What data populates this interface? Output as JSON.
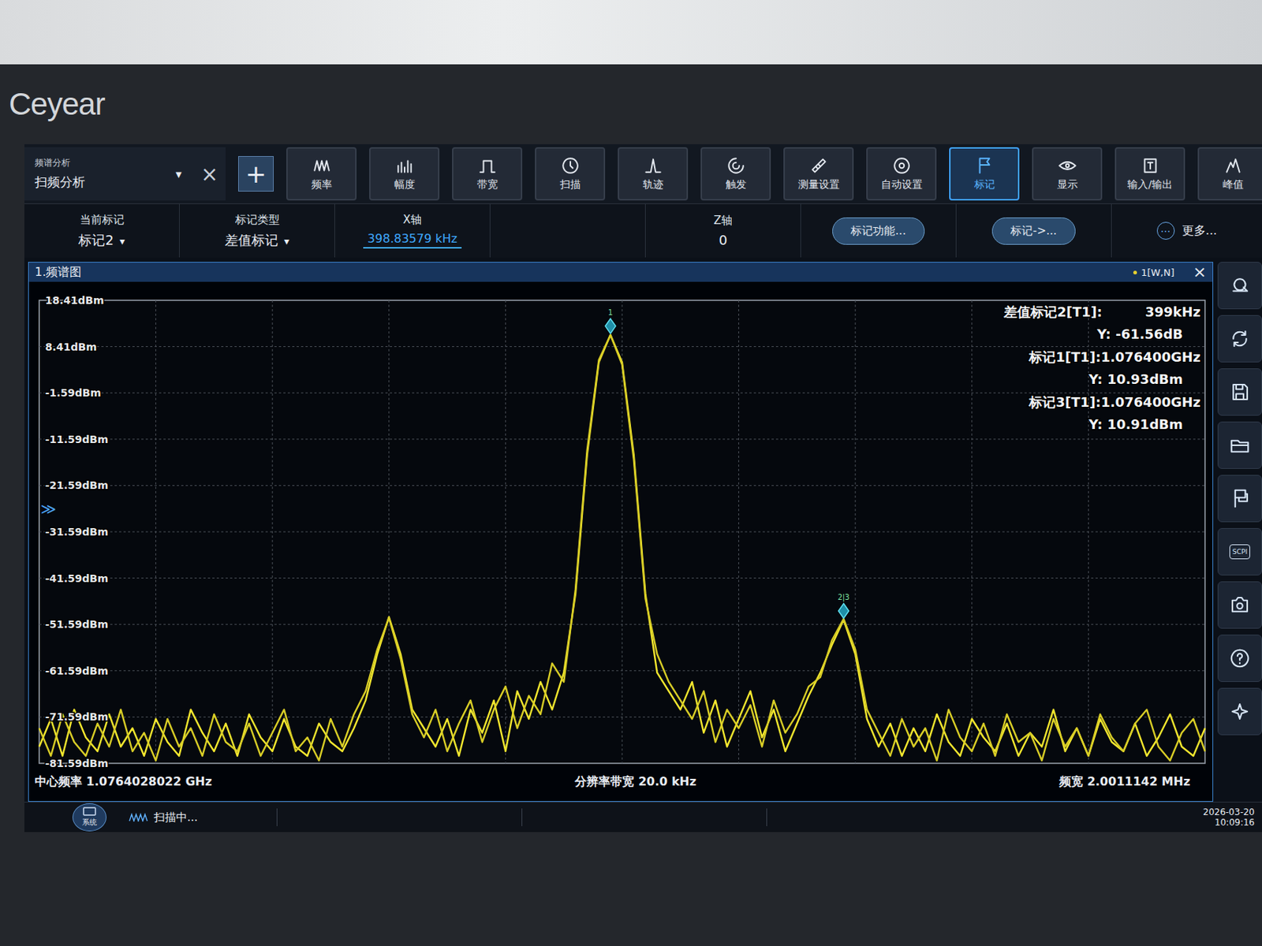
{
  "brand": {
    "logo": "Ceyear"
  },
  "mode": {
    "caption": "频谱分析",
    "value": "扫频分析",
    "dropdown": "▾",
    "close": "×",
    "add": "+"
  },
  "toolbar": [
    {
      "label": "频率",
      "selected": false
    },
    {
      "label": "幅度",
      "selected": false
    },
    {
      "label": "带宽",
      "selected": false
    },
    {
      "label": "扫描",
      "selected": false
    },
    {
      "label": "轨迹",
      "selected": false
    },
    {
      "label": "触发",
      "selected": false
    },
    {
      "label": "测量设置",
      "selected": false
    },
    {
      "label": "自动设置",
      "selected": false
    },
    {
      "label": "标记",
      "selected": true
    },
    {
      "label": "显示",
      "selected": false
    },
    {
      "label": "输入/输出",
      "selected": false
    },
    {
      "label": "峰值",
      "selected": false
    }
  ],
  "marker_bar": {
    "current": {
      "label": "当前标记",
      "value": "标记2",
      "dropdown": "▾"
    },
    "type": {
      "label": "标记类型",
      "value": "差值标记",
      "dropdown": "▾"
    },
    "x_axis": {
      "label": "X轴",
      "value": "398.83579 kHz"
    },
    "z_axis": {
      "label": "Z轴",
      "value": "0"
    },
    "buttons": [
      "标记功能...",
      "标记->..."
    ],
    "more": {
      "icon": "⋯",
      "label": "更多..."
    }
  },
  "panel": {
    "title": "1.频谱图",
    "trace_info": "1[W,N]",
    "close": "×"
  },
  "chart": {
    "y_ticks": [
      "18.41dBm",
      "8.41dBm",
      "-1.59dBm",
      "-11.59dBm",
      "-21.59dBm",
      "-31.59dBm",
      "-41.59dBm",
      "-51.59dBm",
      "-61.59dBm",
      "-71.59dBm",
      "-81.59dBm"
    ],
    "ref_mark": "≫",
    "ref_level": -26.59,
    "series": [
      {
        "color": "#f2e62e",
        "values": [
          -78,
          -72,
          -80,
          -70,
          -76,
          -79,
          -71,
          -78,
          -74,
          -80,
          -72,
          -77,
          -80,
          -70,
          -75,
          -79,
          -73,
          -80,
          -71,
          -76,
          -79,
          -72,
          -78,
          -80,
          -73,
          -77,
          -79,
          -74,
          -68,
          -58,
          -50,
          -58,
          -70,
          -74,
          -78,
          -72,
          -80,
          -70,
          -75,
          -68,
          -79,
          -66,
          -72,
          -64,
          -70,
          -62,
          -45,
          -15,
          5,
          10.93,
          5,
          -15,
          -45,
          -62,
          -66,
          -70,
          -64,
          -75,
          -68,
          -78,
          -72,
          -66,
          -76,
          -70,
          -79,
          -73,
          -67,
          -62,
          -56,
          -50.6,
          -58,
          -72,
          -78,
          -73,
          -80,
          -74,
          -79,
          -71,
          -77,
          -80,
          -72,
          -76,
          -79,
          -73,
          -80,
          -75,
          -78,
          -70,
          -79,
          -74,
          -80,
          -72,
          -77,
          -79,
          -73,
          -80,
          -76,
          -71,
          -78,
          -80,
          -74
        ]
      },
      {
        "color": "#d8cd26",
        "values": [
          -74,
          -80,
          -71,
          -77,
          -80,
          -73,
          -78,
          -70,
          -79,
          -75,
          -81,
          -72,
          -78,
          -74,
          -80,
          -71,
          -77,
          -79,
          -73,
          -80,
          -75,
          -70,
          -79,
          -76,
          -81,
          -72,
          -78,
          -71,
          -66,
          -57,
          -50.2,
          -59,
          -71,
          -76,
          -70,
          -79,
          -73,
          -68,
          -77,
          -70,
          -65,
          -74,
          -67,
          -71,
          -60,
          -64,
          -44,
          -14,
          5.5,
          10.91,
          4.5,
          -16,
          -46,
          -58,
          -64,
          -68,
          -72,
          -66,
          -77,
          -70,
          -74,
          -69,
          -78,
          -68,
          -75,
          -71,
          -65,
          -63,
          -55,
          -50.4,
          -57,
          -70,
          -75,
          -80,
          -72,
          -78,
          -74,
          -81,
          -70,
          -76,
          -79,
          -73,
          -80,
          -71,
          -77,
          -75,
          -81,
          -72,
          -78,
          -74,
          -80,
          -71,
          -76,
          -79,
          -73,
          -70,
          -78,
          -81,
          -75,
          -72,
          -79
        ]
      }
    ],
    "markers": [
      {
        "label": "1",
        "series": 0,
        "at": 49
      },
      {
        "label": "2|3",
        "series": 0,
        "at": 69
      }
    ],
    "readouts": [
      {
        "head": "差值标记2[T1]:",
        "value": "399kHz",
        "y": "Y: -61.56dB"
      },
      {
        "head": "标记1[T1]:1.076400GHz",
        "value": "",
        "y": "Y: 10.93dBm"
      },
      {
        "head": "标记3[T1]:1.076400GHz",
        "value": "",
        "y": "Y: 10.91dBm"
      }
    ]
  },
  "footer": {
    "center": "中心频率 1.0764028022 GHz",
    "rbw": "分辨率带宽 20.0 kHz",
    "span": "频宽 2.0011142 MHz"
  },
  "side_panel": {
    "scpi": "SCPI"
  },
  "status_bar": {
    "system": "系统",
    "state": "扫描中...",
    "date": "2026-03-20",
    "time": "10:09:16"
  }
}
